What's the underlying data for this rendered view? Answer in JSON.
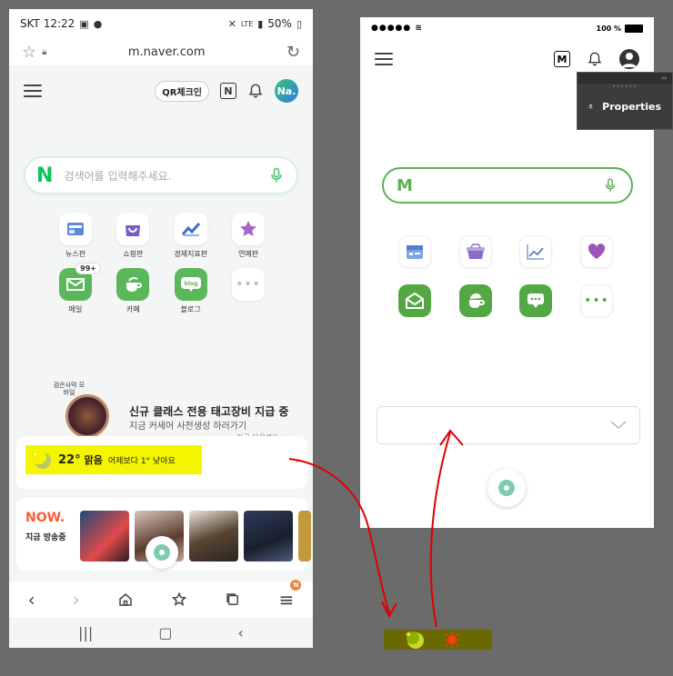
{
  "left_phone": {
    "status": {
      "carrier_time": "SKT 12:22",
      "battery": "50%",
      "network": "LTE"
    },
    "url": "m.naver.com",
    "header": {
      "qr_label": "QR체크인",
      "n_label": "N",
      "avatar_label": "Na."
    },
    "search": {
      "logo": "N",
      "placeholder": "검색어를 입력해주세요."
    },
    "shortcuts": [
      {
        "label": "뉴스판",
        "icon": "newspaper-icon"
      },
      {
        "label": "쇼핑판",
        "icon": "shopping-bag-icon"
      },
      {
        "label": "경제지표판",
        "icon": "chart-icon"
      },
      {
        "label": "연예판",
        "icon": "star-icon"
      },
      {
        "label": "메일",
        "icon": "mail-icon",
        "badge": "99+"
      },
      {
        "label": "카페",
        "icon": "cafe-icon"
      },
      {
        "label": "블로그",
        "icon": "blog-icon"
      },
      {
        "label": "",
        "icon": "more-icon"
      }
    ],
    "promo": {
      "badge": "검은사막 모바일",
      "title": "신규 클래스 전용 태고장비 지급 중",
      "subtitle": "지금 커세어 사전생성 하러가기",
      "more": "지금 다운로드 >"
    },
    "weather": {
      "temp": "22°",
      "condition": "맑음",
      "compare": "어제보다 1° 낮아요"
    },
    "now": {
      "logo": "NOW.",
      "subtitle": "지금 방송중"
    },
    "bottom_nav": {
      "menu_badge": "N"
    }
  },
  "right_phone": {
    "status": {
      "battery": "100 %"
    },
    "header": {
      "m_label": "M"
    },
    "search": {
      "logo": "M"
    }
  },
  "properties_panel": {
    "label": "Properties",
    "collapse": "››"
  },
  "colors": {
    "naver_green": "#03c75a",
    "mock_green": "#53a844",
    "highlight": "#f4f500",
    "annotation_red": "#e00000"
  }
}
